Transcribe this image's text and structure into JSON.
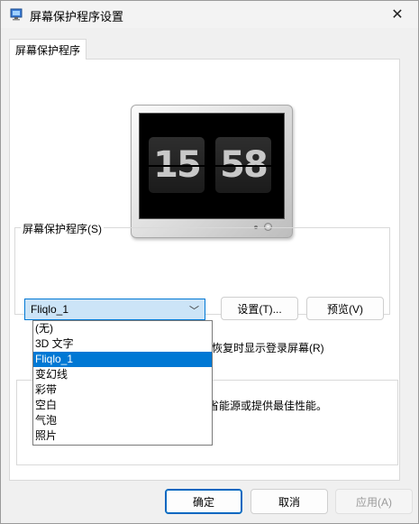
{
  "window": {
    "title": "屏幕保护程序设置",
    "close_glyph": "✕"
  },
  "tabs": [
    {
      "label": "屏幕保护程序"
    }
  ],
  "preview": {
    "hours": "15",
    "minutes": "58"
  },
  "screensaver_group": {
    "label": "屏幕保护程序(S)",
    "selected": "Fliqlo_1",
    "settings_button": "设置(T)...",
    "preview_button": "预览(V)",
    "resume_text": "恢复时显示登录屏幕(R)"
  },
  "dropdown_options": [
    "(无)",
    "3D 文字",
    "Fliqlo_1",
    "变幻线",
    "彩带",
    "空白",
    "气泡",
    "照片"
  ],
  "dropdown_selected_index": 2,
  "power_group": {
    "text": "省能源或提供最佳性能。"
  },
  "footer": {
    "ok": "确定",
    "cancel": "取消",
    "apply": "应用(A)"
  },
  "colors": {
    "accent": "#0078d4",
    "combo_bg": "#cce4f7"
  }
}
